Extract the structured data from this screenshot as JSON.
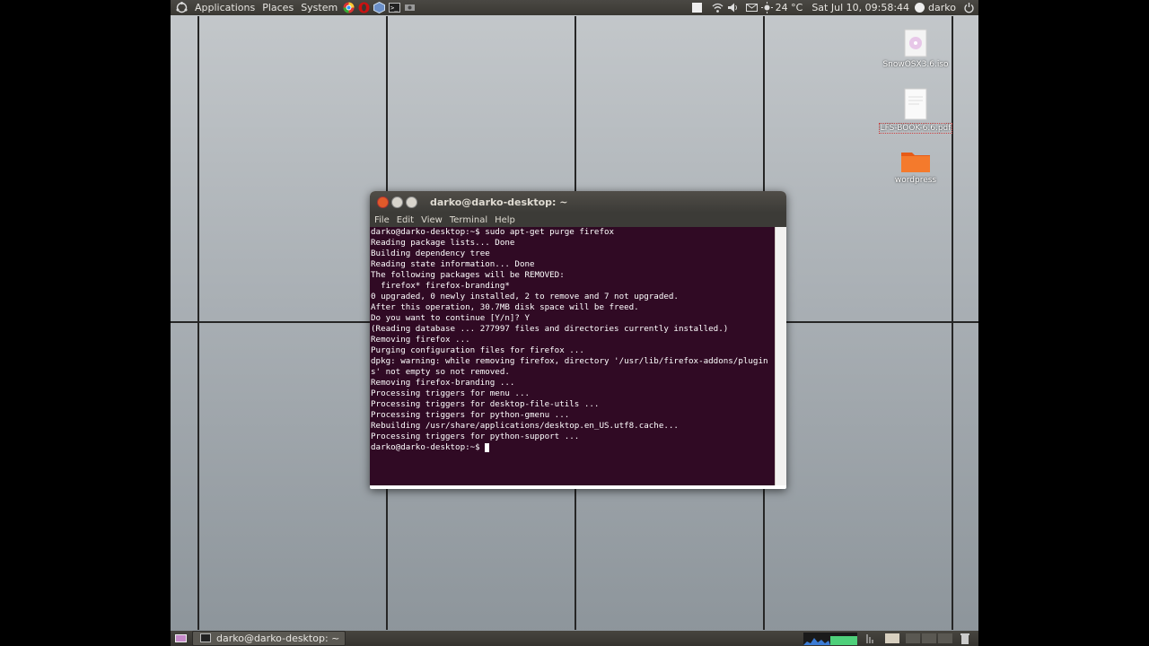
{
  "topbar": {
    "menus": [
      "Applications",
      "Places",
      "System"
    ],
    "weather": "24 °C",
    "clock": "Sat Jul 10, 09:58:44",
    "user": "darko"
  },
  "desktop": {
    "icons": [
      {
        "label": "SnowOSX3.6.iso"
      },
      {
        "label": "LFS-BOOK-6.6.pdf"
      },
      {
        "label": "wordpress"
      }
    ]
  },
  "window": {
    "title": "darko@darko-desktop: ~",
    "menu": [
      "File",
      "Edit",
      "View",
      "Terminal",
      "Help"
    ],
    "prompt": "darko@darko-desktop:~$ ",
    "lines": [
      "darko@darko-desktop:~$ sudo apt-get purge firefox",
      "Reading package lists... Done",
      "Building dependency tree",
      "Reading state information... Done",
      "The following packages will be REMOVED:",
      "  firefox* firefox-branding*",
      "0 upgraded, 0 newly installed, 2 to remove and 7 not upgraded.",
      "After this operation, 30.7MB disk space will be freed.",
      "Do you want to continue [Y/n]? Y",
      "(Reading database ... 277997 files and directories currently installed.)",
      "Removing firefox ...",
      "Purging configuration files for firefox ...",
      "dpkg: warning: while removing firefox, directory '/usr/lib/firefox-addons/plugin",
      "s' not empty so not removed.",
      "Removing firefox-branding ...",
      "Processing triggers for menu ...",
      "Processing triggers for desktop-file-utils ...",
      "Processing triggers for python-gmenu ...",
      "Rebuilding /usr/share/applications/desktop.en_US.utf8.cache...",
      "Processing triggers for python-support ..."
    ]
  },
  "taskbar": {
    "task": "darko@darko-desktop: ~"
  }
}
